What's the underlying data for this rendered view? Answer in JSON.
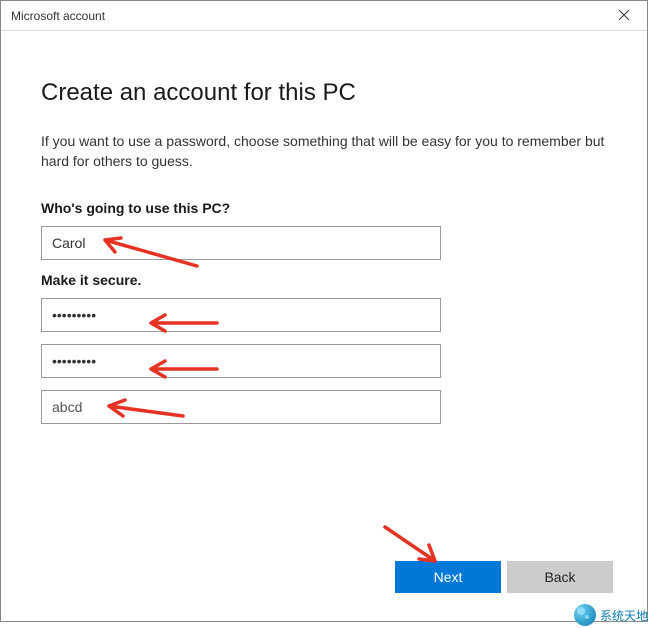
{
  "window": {
    "title": "Microsoft account"
  },
  "main": {
    "heading": "Create an account for this PC",
    "instructions": "If you want to use a password, choose something that will be easy for you to remember but hard for others to guess.",
    "section1_label": "Who's going to use this PC?",
    "username_value": "Carol",
    "section2_label": "Make it secure.",
    "password_value": "•••••••••",
    "confirm_value": "•••••••••",
    "hint_value": "abcd"
  },
  "buttons": {
    "next": "Next",
    "back": "Back"
  },
  "watermark": {
    "text": "系统天地"
  }
}
